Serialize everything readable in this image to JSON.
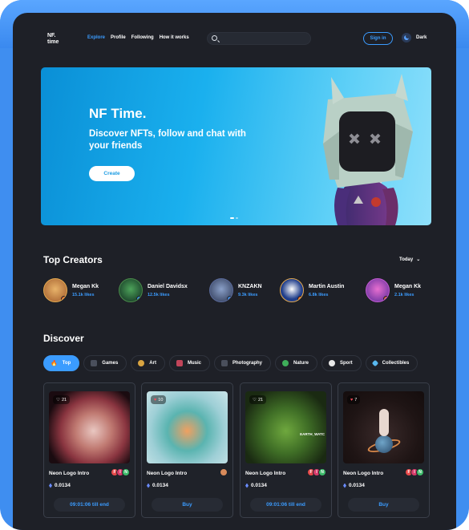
{
  "header": {
    "logo": "NF.\ntime",
    "nav": [
      "Explore",
      "Profile",
      "Following",
      "How it works"
    ],
    "search_placeholder": "",
    "signin": "Sign in",
    "theme": "Dark"
  },
  "hero": {
    "title": "NF Time.",
    "subtitle": "Discover NFTs, follow and chat with your friends",
    "cta": "Create"
  },
  "top_creators": {
    "title": "Top Creators",
    "filter": "Today",
    "items": [
      {
        "name": "Megan Kk",
        "likes": "15.1k likes"
      },
      {
        "name": "Daniel Davidsx",
        "likes": "12.5k likes"
      },
      {
        "name": "KNZAKN",
        "likes": "9.3k likes"
      },
      {
        "name": "Martin Austin",
        "likes": "6.8k likes"
      },
      {
        "name": "Megan Kk",
        "likes": "2.1k likes"
      }
    ]
  },
  "discover": {
    "title": "Discover",
    "chips": [
      "Top",
      "Games",
      "Art",
      "Music",
      "Photography",
      "Nature",
      "Sport",
      "Collectibles"
    ],
    "cards": [
      {
        "likes": "21",
        "title": "Neon Logo Intro",
        "price": "0.0134",
        "action": "09:01:06 till  end"
      },
      {
        "likes": "10",
        "title": "Neon Logo Intro",
        "price": "0.0134",
        "action": "Buy"
      },
      {
        "likes": "21",
        "title": "Neon Logo Intro",
        "price": "0.0134",
        "action": "09:01:06 till  end",
        "image_text": "EARTH_WATC"
      },
      {
        "likes": "7",
        "title": "Neon Logo Intro",
        "price": "0.0134",
        "action": "Buy"
      }
    ]
  },
  "colors": {
    "accent": "#3b9cff",
    "background": "#1e2027",
    "frame": "#3f8ef0"
  }
}
